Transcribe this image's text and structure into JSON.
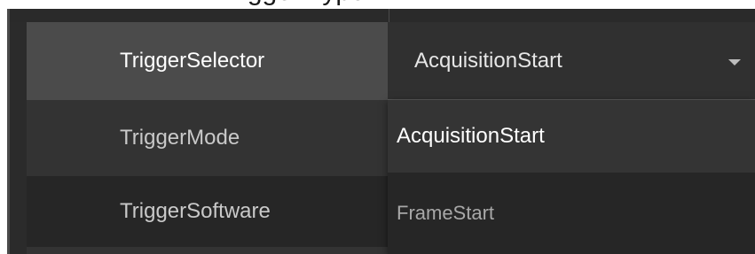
{
  "header": {
    "title_partial": "…Trigger Type…"
  },
  "properties": [
    {
      "name": "TriggerSelector",
      "selected": true
    },
    {
      "name": "TriggerMode"
    },
    {
      "name": "TriggerSoftware"
    },
    {
      "name": ""
    }
  ],
  "selector": {
    "value": "AcquisitionStart",
    "options": [
      "AcquisitionStart",
      "FrameStart"
    ],
    "highlighted_index": 0
  },
  "colors": {
    "panel_bg": "#2b2b2b",
    "selected_row": "#4b4b4b",
    "dropdown_bg": "#262626",
    "dropdown_highlight": "#343434"
  },
  "icons": {
    "select_arrow": "chevron-down-icon"
  }
}
